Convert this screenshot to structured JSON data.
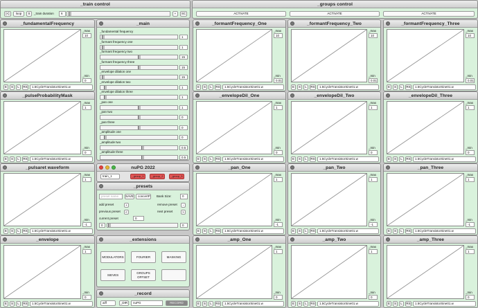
{
  "train": {
    "title": "_train control",
    "loop_icon": "[<]",
    "loop": "loop",
    "s": "S",
    "duration_label": "_train duration",
    "duration": "6",
    "plus": "+",
    "sc": "SC"
  },
  "groups": {
    "title": "_groups control",
    "activate": "ACTIVATE"
  },
  "table": {
    "max": "_max",
    "min": "_min",
    "e": "E",
    "s": "S",
    "l": "L",
    "rs": "RS",
    "wave": "1.5CycleTransistorSine01.w"
  },
  "tables": [
    {
      "title": "_fundamentalFrequency",
      "max": "10",
      "min": "0"
    },
    {
      "title": "_formantFrequency_One",
      "max": "10",
      "min": "0.01"
    },
    {
      "title": "_formantFrequency_Two",
      "max": "10",
      "min": "0.01"
    },
    {
      "title": "_formantFrequency_Three",
      "max": "10",
      "min": "0.01"
    },
    {
      "title": "_pulseProbabilityMask",
      "max": "1",
      "min": "0"
    },
    {
      "title": "_envelopeDil_One",
      "max": "1",
      "min": "0"
    },
    {
      "title": "_envelopeDil_Two",
      "max": "1",
      "min": "0"
    },
    {
      "title": "_envelopeDil_Three",
      "max": "1",
      "min": "0"
    },
    {
      "title": "_pulsaret waveform",
      "max": "1",
      "min": "-1"
    },
    {
      "title": "_pan_One",
      "max": "1",
      "min": "-1"
    },
    {
      "title": "_pan_Two",
      "max": "1",
      "min": "-1"
    },
    {
      "title": "_pan_Three",
      "max": "1",
      "min": "-1"
    },
    {
      "title": "_envelope",
      "max": "1",
      "min": "0"
    },
    {
      "title": "_amp_One",
      "max": "1",
      "min": "0"
    },
    {
      "title": "_amp_Two",
      "max": "1",
      "min": "0"
    },
    {
      "title": "_amp_Three",
      "max": "1",
      "min": "0"
    }
  ],
  "main": {
    "title": "_main",
    "params": [
      {
        "label": "_fundamental frequency",
        "value": "1"
      },
      {
        "label": "_formant frequency one",
        "value": "1"
      },
      {
        "label": "_formant frequency two",
        "value": "15"
      },
      {
        "label": "_formant frequency three",
        "value": "15"
      },
      {
        "label": "_envelope dilation one",
        "value": "15"
      },
      {
        "label": "_envelope dilation two",
        "value": "1"
      },
      {
        "label": "_envelope dilation three",
        "value": "1"
      },
      {
        "label": "_pan one",
        "value": "1"
      },
      {
        "label": "_pan two",
        "value": "0"
      },
      {
        "label": "_pan three",
        "value": "0"
      },
      {
        "label": "_amplitude one",
        "value": "0"
      },
      {
        "label": "_amplitude two",
        "value": "0.5"
      },
      {
        "label": "_amplitude three",
        "value": "0.5"
      }
    ],
    "last": "0.5"
  },
  "nupg": {
    "title": "nuPG 2022",
    "train": "train_1",
    "group1": "_group_1",
    "group2": "_group_2",
    "group3": "_group_3"
  },
  "presets": {
    "title": "_presets",
    "name_placeholder": "preset name",
    "save": "SAVE",
    "concert": "concertP",
    "bank_label": "Bank Size:",
    "bank": "0",
    "add": "add preset",
    "remove": "remove preset",
    "previous": "previous preset",
    "next": "next preset",
    "current": "current preset",
    "current_val": "0",
    "plus": "+",
    "minus": "-",
    "lt": "<",
    "gt": ">",
    "slider_val": "0"
  },
  "extensions": {
    "title": "_extensions",
    "buttons": [
      "MODULATORS",
      "FOURIER",
      "MASKING",
      "SIEVES",
      "GROUPS OFFSET",
      ""
    ]
  },
  "record": {
    "title": "_record",
    "mode": "aiff",
    "dir": "_DIR",
    "name": "nuPG",
    "record": "RECORD"
  }
}
